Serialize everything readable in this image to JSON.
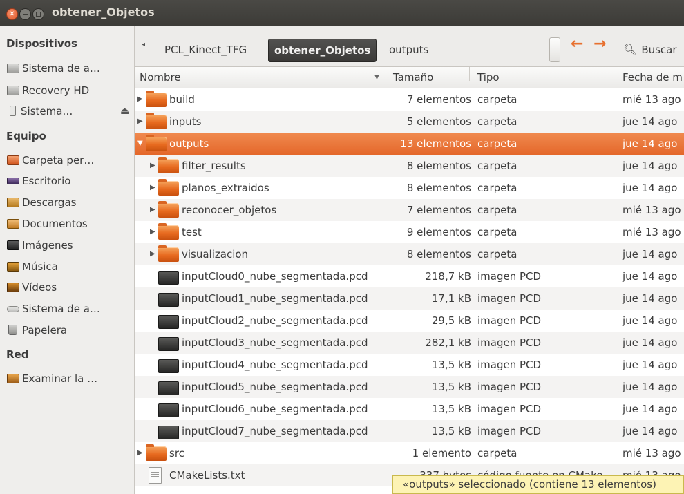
{
  "window": {
    "title": "obtener_Objetos"
  },
  "sidebar": {
    "sections": [
      {
        "heading": "Dispositivos",
        "items": [
          {
            "label": "Sistema de a…",
            "icon": "drive-icon"
          },
          {
            "label": "Recovery HD",
            "icon": "drive-icon"
          },
          {
            "label": "Sistema…",
            "icon": "usb-drive-icon",
            "eject": "⏏"
          }
        ]
      },
      {
        "heading": "Equipo",
        "items": [
          {
            "label": "Carpeta per…",
            "icon": "home-folder-icon"
          },
          {
            "label": "Escritorio",
            "icon": "desktop-icon"
          },
          {
            "label": "Descargas",
            "icon": "downloads-icon"
          },
          {
            "label": "Documentos",
            "icon": "documents-icon"
          },
          {
            "label": "Imágenes",
            "icon": "pictures-icon"
          },
          {
            "label": "Música",
            "icon": "music-icon"
          },
          {
            "label": "Vídeos",
            "icon": "videos-icon"
          },
          {
            "label": "Sistema de a…",
            "icon": "filesystem-icon"
          },
          {
            "label": "Papelera",
            "icon": "trash-icon"
          }
        ]
      },
      {
        "heading": "Red",
        "items": [
          {
            "label": "Examinar la …",
            "icon": "network-icon"
          }
        ]
      }
    ]
  },
  "toolbar": {
    "breadcrumbs": [
      "PCL_Kinect_TFG",
      "obtener_Objetos",
      "outputs"
    ],
    "active_crumb": "obtener_Objetos",
    "search_label": "Buscar"
  },
  "columns": {
    "name": "Nombre",
    "size": "Tamaño",
    "type": "Tipo",
    "date": "Fecha de m"
  },
  "rows": [
    {
      "name": "build",
      "size": "7 elementos",
      "type": "carpeta",
      "date": "mié 13 ago",
      "kind": "folder",
      "level": 0,
      "expander": "▶"
    },
    {
      "name": "inputs",
      "size": "5 elementos",
      "type": "carpeta",
      "date": "jue 14 ago",
      "kind": "folder",
      "level": 0,
      "expander": "▶"
    },
    {
      "name": "outputs",
      "size": "13 elementos",
      "type": "carpeta",
      "date": "jue 14 ago",
      "kind": "folder",
      "level": 0,
      "expander": "▼",
      "selected": true
    },
    {
      "name": "filter_results",
      "size": "8 elementos",
      "type": "carpeta",
      "date": "jue 14 ago",
      "kind": "folder",
      "level": 1,
      "expander": "▶"
    },
    {
      "name": "planos_extraidos",
      "size": "8 elementos",
      "type": "carpeta",
      "date": "jue 14 ago",
      "kind": "folder",
      "level": 1,
      "expander": "▶"
    },
    {
      "name": "reconocer_objetos",
      "size": "7 elementos",
      "type": "carpeta",
      "date": "mié 13 ago",
      "kind": "folder",
      "level": 1,
      "expander": "▶"
    },
    {
      "name": "test",
      "size": "9 elementos",
      "type": "carpeta",
      "date": "mié 13 ago",
      "kind": "folder",
      "level": 1,
      "expander": "▶"
    },
    {
      "name": "visualizacion",
      "size": "8 elementos",
      "type": "carpeta",
      "date": "jue 14 ago",
      "kind": "folder",
      "level": 1,
      "expander": "▶"
    },
    {
      "name": "inputCloud0_nube_segmentada.pcd",
      "size": "218,7 kB",
      "type": "imagen PCD",
      "date": "jue 14 ago",
      "kind": "image",
      "level": 1,
      "expander": ""
    },
    {
      "name": "inputCloud1_nube_segmentada.pcd",
      "size": "17,1 kB",
      "type": "imagen PCD",
      "date": "jue 14 ago",
      "kind": "image",
      "level": 1,
      "expander": ""
    },
    {
      "name": "inputCloud2_nube_segmentada.pcd",
      "size": "29,5 kB",
      "type": "imagen PCD",
      "date": "jue 14 ago",
      "kind": "image",
      "level": 1,
      "expander": ""
    },
    {
      "name": "inputCloud3_nube_segmentada.pcd",
      "size": "282,1 kB",
      "type": "imagen PCD",
      "date": "jue 14 ago",
      "kind": "image",
      "level": 1,
      "expander": ""
    },
    {
      "name": "inputCloud4_nube_segmentada.pcd",
      "size": "13,5 kB",
      "type": "imagen PCD",
      "date": "jue 14 ago",
      "kind": "image",
      "level": 1,
      "expander": ""
    },
    {
      "name": "inputCloud5_nube_segmentada.pcd",
      "size": "13,5 kB",
      "type": "imagen PCD",
      "date": "jue 14 ago",
      "kind": "image",
      "level": 1,
      "expander": ""
    },
    {
      "name": "inputCloud6_nube_segmentada.pcd",
      "size": "13,5 kB",
      "type": "imagen PCD",
      "date": "jue 14 ago",
      "kind": "image",
      "level": 1,
      "expander": ""
    },
    {
      "name": "inputCloud7_nube_segmentada.pcd",
      "size": "13,5 kB",
      "type": "imagen PCD",
      "date": "jue 14 ago",
      "kind": "image",
      "level": 1,
      "expander": ""
    },
    {
      "name": "src",
      "size": "1 elemento",
      "type": "carpeta",
      "date": "mié 13 ago",
      "kind": "folder",
      "level": 0,
      "expander": "▶"
    },
    {
      "name": "CMakeLists.txt",
      "size": "337 bytes",
      "type": "código fuente en CMake",
      "date": "mié 13 ago",
      "kind": "text",
      "level": 0,
      "expander": ""
    }
  ],
  "status": {
    "text": "«outputs» seleccionado (contiene 13 elementos)"
  },
  "colors": {
    "accent": "#e4672a",
    "titlebar": "#3c3b37",
    "status_bg": "#fdf3b4"
  }
}
